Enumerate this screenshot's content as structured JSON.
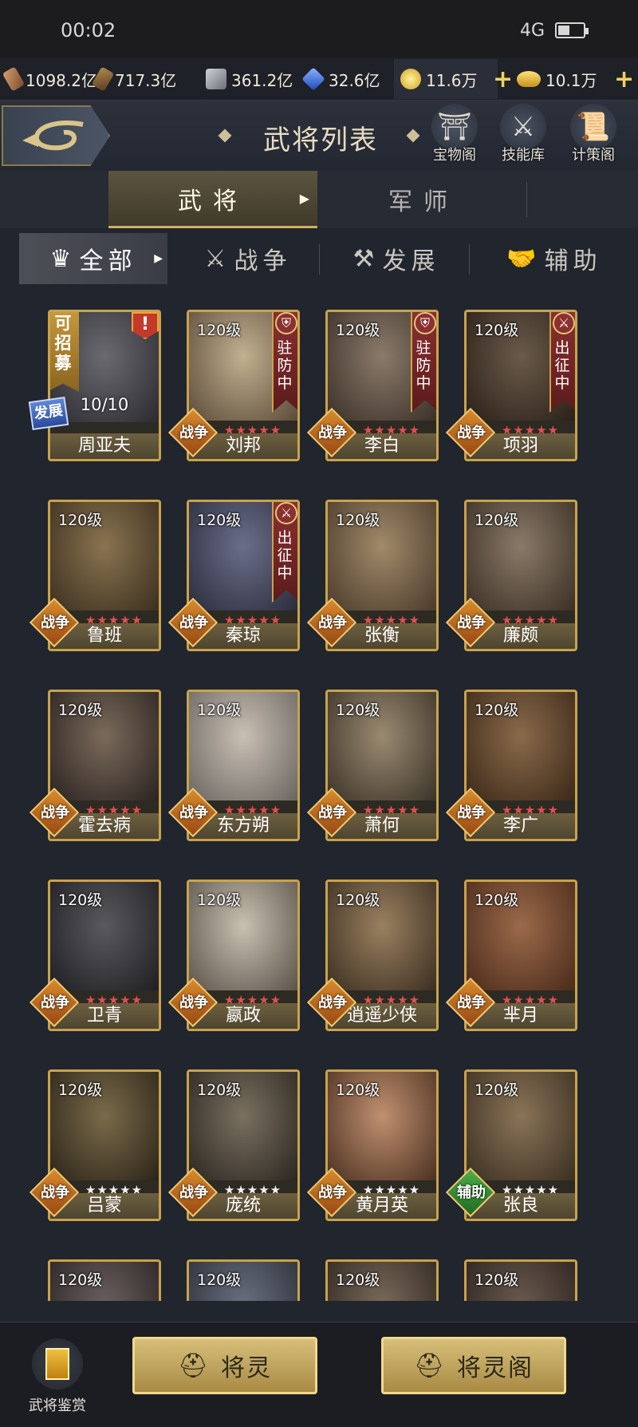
{
  "status": {
    "time": "00:02",
    "network": "4G",
    "battery_level": 0.45
  },
  "resources": [
    {
      "name": "wood-resource",
      "value": "1098.2亿",
      "color": "#b07a4a"
    },
    {
      "name": "iron-resource",
      "value": "717.3亿",
      "color": "#8a6a3e"
    },
    {
      "name": "stone-resource",
      "value": "361.2亿",
      "color": "#9ea2a8"
    },
    {
      "name": "crystal-resource",
      "value": "32.6亿",
      "color": "#4a7ad8"
    },
    {
      "name": "coin-resource",
      "value": "11.6万",
      "color": "#e6c23a"
    },
    {
      "name": "ingot-resource",
      "value": "10.1万",
      "color": "#f0c040"
    }
  ],
  "header": {
    "title": "武将列表",
    "icons": [
      {
        "name": "treasure-pavilion-icon",
        "label": "宝物阁"
      },
      {
        "name": "skill-library-icon",
        "label": "技能库"
      },
      {
        "name": "strategy-pavilion-icon",
        "label": "计策阁"
      }
    ]
  },
  "main_tabs": [
    {
      "label": "武将",
      "active": true
    },
    {
      "label": "军师",
      "active": false
    }
  ],
  "filter_tabs": [
    {
      "label": "全部",
      "icon": "all-icon",
      "active": true
    },
    {
      "label": "战争",
      "icon": "crossed-swords-icon",
      "active": false
    },
    {
      "label": "发展",
      "icon": "hammer-icon",
      "active": false
    },
    {
      "label": "辅助",
      "icon": "handshake-icon",
      "active": false
    }
  ],
  "generals": [
    {
      "name": "周亚夫",
      "recruitable": "可招募",
      "progress": "10/10",
      "badge": "发展"
    },
    {
      "name": "刘邦",
      "level": "120级",
      "badge": "战争",
      "status": "驻防中",
      "stars": "★★★★★",
      "star_color": "red"
    },
    {
      "name": "李白",
      "level": "120级",
      "badge": "战争",
      "status": "驻防中",
      "stars": "★★★★★",
      "star_color": "red"
    },
    {
      "name": "项羽",
      "level": "120级",
      "badge": "战争",
      "status": "出征中",
      "stars": "★★★★★",
      "star_color": "red"
    },
    {
      "name": "鲁班",
      "level": "120级",
      "badge": "战争",
      "stars": "★★★★★",
      "star_color": "red"
    },
    {
      "name": "秦琼",
      "level": "120级",
      "badge": "战争",
      "status": "出征中",
      "stars": "★★★★★",
      "star_color": "red"
    },
    {
      "name": "张衡",
      "level": "120级",
      "badge": "战争",
      "stars": "★★★★★",
      "star_color": "red"
    },
    {
      "name": "廉颇",
      "level": "120级",
      "badge": "战争",
      "stars": "★★★★★",
      "star_color": "red"
    },
    {
      "name": "霍去病",
      "level": "120级",
      "badge": "战争",
      "stars": "★★★★★",
      "star_color": "red"
    },
    {
      "name": "东方朔",
      "level": "120级",
      "badge": "战争",
      "stars": "★★★★★",
      "star_color": "red"
    },
    {
      "name": "萧何",
      "level": "120级",
      "badge": "战争",
      "stars": "★★★★★",
      "star_color": "red"
    },
    {
      "name": "李广",
      "level": "120级",
      "badge": "战争",
      "stars": "★★★★★",
      "star_color": "red"
    },
    {
      "name": "卫青",
      "level": "120级",
      "badge": "战争",
      "stars": "★★★★★",
      "star_color": "red"
    },
    {
      "name": "嬴政",
      "level": "120级",
      "badge": "战争",
      "stars": "★★★★★",
      "star_color": "red"
    },
    {
      "name": "逍遥少侠",
      "level": "120级",
      "badge": "战争",
      "stars": "★★★★★",
      "star_color": "red"
    },
    {
      "name": "芈月",
      "level": "120级",
      "badge": "战争",
      "stars": "★★★★★",
      "star_color": "red"
    },
    {
      "name": "吕蒙",
      "level": "120级",
      "badge": "战争",
      "stars": "★★★★★",
      "star_color": "white"
    },
    {
      "name": "庞统",
      "level": "120级",
      "badge": "战争",
      "stars": "★★★★★",
      "star_color": "white"
    },
    {
      "name": "黄月英",
      "level": "120级",
      "badge": "战争",
      "stars": "★★★★★",
      "star_color": "white"
    },
    {
      "name": "张良",
      "level": "120级",
      "badge": "辅助",
      "stars": "★★★★★",
      "star_color": "white"
    },
    {
      "level": "120级"
    },
    {
      "level": "120级"
    },
    {
      "level": "120级"
    },
    {
      "level": "120级"
    }
  ],
  "bottom": {
    "appraise_label": "武将鉴赏",
    "spirit_button": "将灵",
    "spirit_pavilion_button": "将灵阁"
  }
}
